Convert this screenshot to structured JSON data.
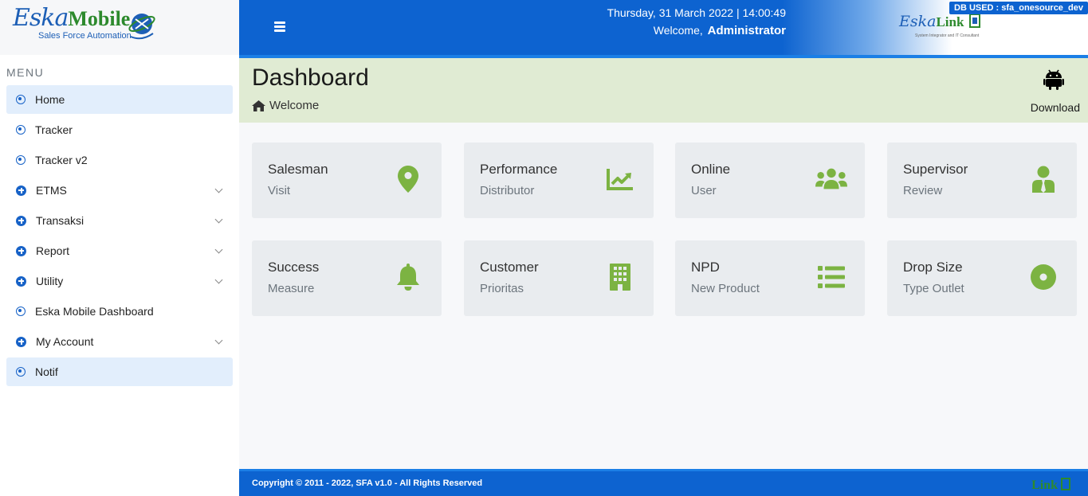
{
  "brand": {
    "name_part1": "Eska",
    "name_part2": "Mobile",
    "tagline": "Sales Force Automation"
  },
  "sidebar": {
    "menu_title": "MENU",
    "items": [
      {
        "label": "Home",
        "icon": "circle-dot-icon",
        "expandable": false,
        "active": true
      },
      {
        "label": "Tracker",
        "icon": "circle-dot-icon",
        "expandable": false,
        "active": false
      },
      {
        "label": "Tracker v2",
        "icon": "circle-dot-icon",
        "expandable": false,
        "active": false
      },
      {
        "label": "ETMS",
        "icon": "plus-circle-icon",
        "expandable": true,
        "active": false
      },
      {
        "label": "Transaksi",
        "icon": "plus-circle-icon",
        "expandable": true,
        "active": false
      },
      {
        "label": "Report",
        "icon": "plus-circle-icon",
        "expandable": true,
        "active": false
      },
      {
        "label": "Utility",
        "icon": "plus-circle-icon",
        "expandable": true,
        "active": false
      },
      {
        "label": "Eska Mobile Dashboard",
        "icon": "circle-dot-icon",
        "expandable": false,
        "active": false
      },
      {
        "label": "My Account",
        "icon": "plus-circle-icon",
        "expandable": true,
        "active": false
      },
      {
        "label": "Notif",
        "icon": "circle-dot-icon",
        "expandable": false,
        "active": true
      }
    ]
  },
  "header": {
    "datetime": "Thursday, 31 March 2022 | 14:00:49",
    "welcome_prefix": "Welcome,",
    "user": "Administrator",
    "partner_logo_part1": "Eska",
    "partner_logo_part2": "Link",
    "partner_logo_sub": "System Integrator and IT Consultant",
    "db_badge": "DB USED : sfa_onesource_dev"
  },
  "page": {
    "title": "Dashboard",
    "breadcrumb": "Welcome",
    "download_label": "Download"
  },
  "cards": [
    {
      "title": "Salesman",
      "subtitle": "Visit",
      "icon": "map-marker-icon"
    },
    {
      "title": "Performance",
      "subtitle": "Distributor",
      "icon": "line-chart-icon"
    },
    {
      "title": "Online",
      "subtitle": "User",
      "icon": "users-icon"
    },
    {
      "title": "Supervisor",
      "subtitle": "Review",
      "icon": "user-tie-icon"
    },
    {
      "title": "Success",
      "subtitle": "Measure",
      "icon": "bell-icon"
    },
    {
      "title": "Customer",
      "subtitle": "Prioritas",
      "icon": "building-icon"
    },
    {
      "title": "NPD",
      "subtitle": "New Product",
      "icon": "list-icon"
    },
    {
      "title": "Drop Size",
      "subtitle": "Type Outlet",
      "icon": "dot-circle-icon"
    }
  ],
  "footer": {
    "copyright": "Copyright © 2011 - 2022, SFA v1.0 - All Rights Reserved",
    "logo_text": "Link"
  },
  "colors": {
    "primary": "#0d63d0",
    "accent_green": "#7cb342",
    "banner_bg": "#e0ebd3",
    "card_bg": "#e9ecef"
  }
}
